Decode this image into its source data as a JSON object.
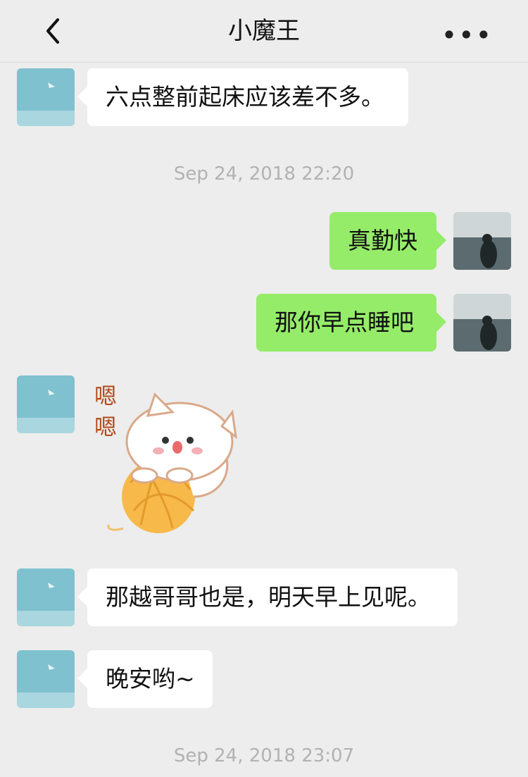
{
  "header": {
    "title": "小魔王",
    "back_icon": "chevron-left-icon",
    "more_label": "•••"
  },
  "messages": [
    {
      "side": "left",
      "text": "六点整前起床应该差不多。"
    },
    {
      "timestamp": "Sep 24, 2018 22:20"
    },
    {
      "side": "right",
      "text": "真勤快"
    },
    {
      "side": "right",
      "text": "那你早点睡吧"
    },
    {
      "side": "left",
      "sticker": "cat-with-yarn-sticker",
      "sticker_text": "嗯\n嗯"
    },
    {
      "side": "left",
      "text": "那越哥哥也是，明天早上见呢。"
    },
    {
      "side": "left",
      "text": "晚安哟~"
    },
    {
      "timestamp": "Sep 24, 2018 23:07"
    }
  ],
  "colors": {
    "background": "#ededed",
    "self_bubble": "#95ec69",
    "other_bubble": "#ffffff"
  }
}
